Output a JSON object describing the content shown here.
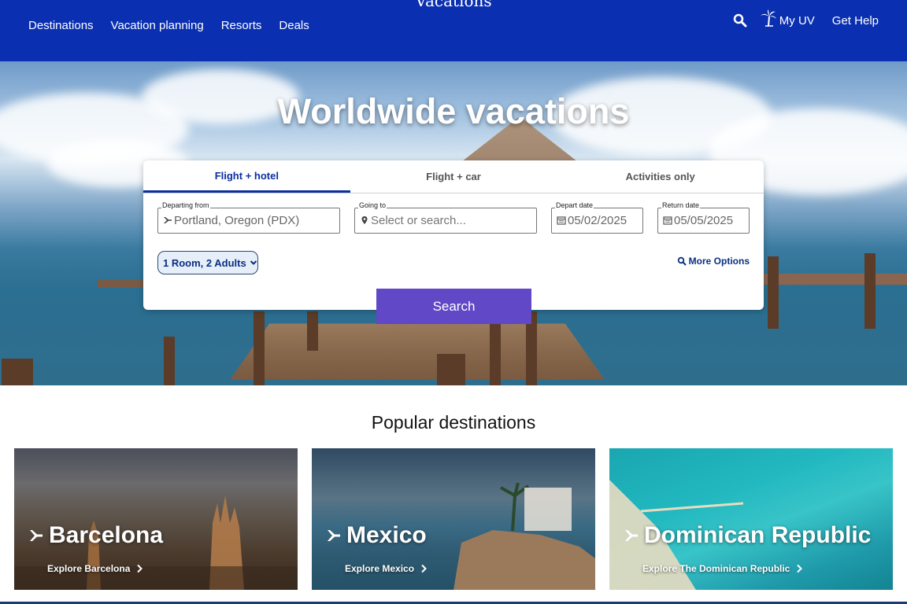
{
  "header": {
    "brand": "Vacations",
    "nav": [
      "Destinations",
      "Vacation planning",
      "Resorts",
      "Deals"
    ],
    "my_uv": "My UV",
    "get_help": "Get Help"
  },
  "hero": {
    "title": "Worldwide vacations"
  },
  "booking": {
    "tabs": [
      "Flight + hotel",
      "Flight + car",
      "Activities only"
    ],
    "active_tab": "Flight + hotel",
    "departing_label": "Departing from",
    "departing_value": "Portland, Oregon (PDX)",
    "going_label": "Going to",
    "going_placeholder": "Select or search...",
    "depart_label": "Depart date",
    "depart_value": "05/02/2025",
    "return_label": "Return date",
    "return_value": "05/05/2025",
    "rooms": "1 Room, 2 Adults",
    "more_options": "More Options",
    "search": "Search"
  },
  "popular": {
    "title": "Popular destinations",
    "items": [
      {
        "name": "Barcelona",
        "link": "Explore Barcelona"
      },
      {
        "name": "Mexico",
        "link": "Explore Mexico"
      },
      {
        "name": "Dominican Republic",
        "link": "Explore The Dominican Republic"
      }
    ]
  },
  "colors": {
    "header_bg": "#0a2fb0",
    "search_button": "#6048c6",
    "accent": "#0a2fa0"
  }
}
